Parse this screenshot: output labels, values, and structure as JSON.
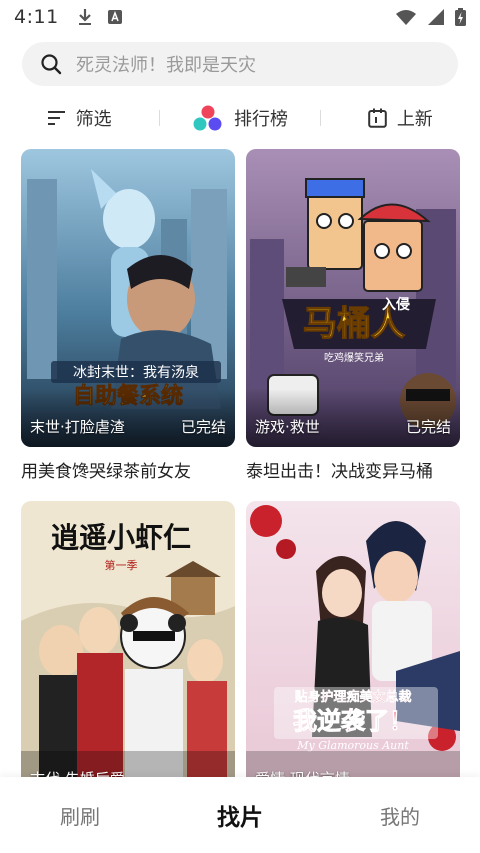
{
  "status_bar": {
    "time": "4:11"
  },
  "search": {
    "placeholder": "死灵法师！我即是天灾"
  },
  "filters": [
    {
      "label": "筛选",
      "icon": "filter-icon"
    },
    {
      "label": "排行榜",
      "icon": "ranking-icon"
    },
    {
      "label": "上新",
      "icon": "calendar-icon"
    }
  ],
  "cards": [
    {
      "title": "用美食馋哭绿茶前女友",
      "genre": "末世·打脸虐渣",
      "status": "已完结",
      "cover_text": [
        "冰封末世：我有汤泉",
        "自助餐系统"
      ]
    },
    {
      "title": "泰坦出击！决战变异马桶",
      "genre": "游戏·救世",
      "status": "已完结",
      "cover_text": [
        "马桶人",
        "入侵",
        "吃鸡爆笑兄弟"
      ]
    },
    {
      "title": "",
      "genre": "古代·先婚后爱",
      "status": "",
      "cover_text": [
        "逍遥小虾仁",
        "第一季"
      ]
    },
    {
      "title": "",
      "genre": "爱情·现代言情",
      "status": "",
      "cover_text": [
        "贴身护理痴美女总裁",
        "我逆袭了！",
        "My Glamorous Aunt"
      ]
    }
  ],
  "bottom_nav": [
    {
      "label": "刷刷",
      "active": false
    },
    {
      "label": "找片",
      "active": true
    },
    {
      "label": "我的",
      "active": false
    }
  ]
}
